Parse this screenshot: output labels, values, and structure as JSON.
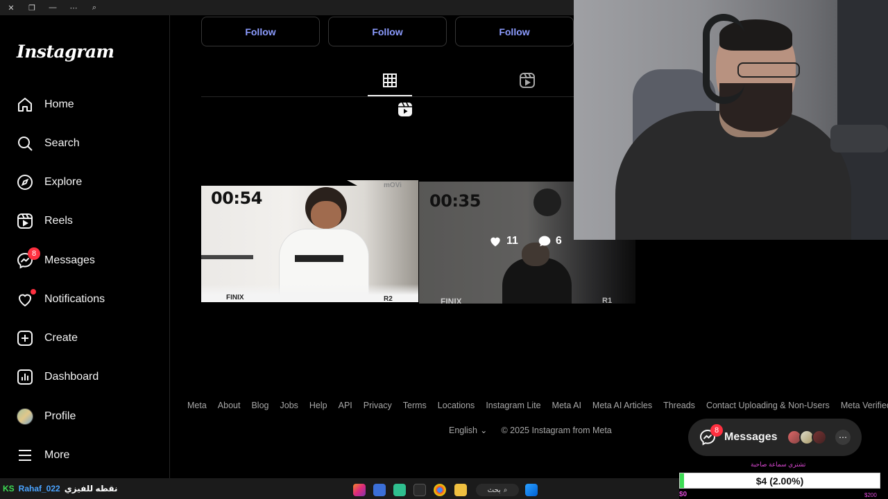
{
  "browser": {
    "buttons": [
      "close-icon",
      "restore-icon",
      "minimize-icon",
      "more-icon",
      "zoom-icon"
    ]
  },
  "instagram": {
    "logo": "Instagram",
    "nav": [
      {
        "label": "Home",
        "icon": "home-icon"
      },
      {
        "label": "Search",
        "icon": "search-icon"
      },
      {
        "label": "Explore",
        "icon": "compass-icon"
      },
      {
        "label": "Reels",
        "icon": "reels-icon"
      },
      {
        "label": "Messages",
        "icon": "messenger-icon",
        "badge": "8"
      },
      {
        "label": "Notifications",
        "icon": "heart-icon",
        "dot": true
      },
      {
        "label": "Create",
        "icon": "plus-square-icon"
      },
      {
        "label": "Dashboard",
        "icon": "bar-chart-icon"
      },
      {
        "label": "Profile",
        "icon": "avatar"
      },
      {
        "label": "More",
        "icon": "menu-icon"
      }
    ]
  },
  "suggestions": {
    "follow_labels": [
      "Follow",
      "Follow",
      "Follow"
    ]
  },
  "tabs": {
    "active": "grid",
    "items": [
      "grid-icon",
      "reels-icon"
    ]
  },
  "posts": [
    {
      "timer": "00:54",
      "left_tag": "FINIX",
      "right_tag": "R2",
      "watermark": "mOVi"
    },
    {
      "timer": "00:35",
      "left_tag": "FINIX",
      "right_tag": "R1",
      "likes": "11",
      "comments": "6"
    }
  ],
  "footer": {
    "links": [
      "Meta",
      "About",
      "Blog",
      "Jobs",
      "Help",
      "API",
      "Privacy",
      "Terms",
      "Locations",
      "Instagram Lite",
      "Meta AI",
      "Meta AI Articles",
      "Threads",
      "Contact Uploading & Non-Users",
      "Meta Verified"
    ],
    "language": "English",
    "copyright": "© 2025 Instagram from Meta"
  },
  "messages_pill": {
    "label": "Messages",
    "badge": "8"
  },
  "donation": {
    "title": "تشتري سماعة صاحبة",
    "amount_text": "$4 (2.00%)",
    "progress_fraction": 0.02,
    "min_label": "$0",
    "max_label": "$200"
  },
  "taskbar": {
    "ticker_prefix": "KS",
    "ticker_user": "Rahaf_022",
    "ticker_text": "نقطه للفيزي",
    "search_label": "بحث"
  },
  "colors": {
    "accent_link": "#8c9cff",
    "badge": "#ff3040",
    "progress": "#3ddc54"
  }
}
